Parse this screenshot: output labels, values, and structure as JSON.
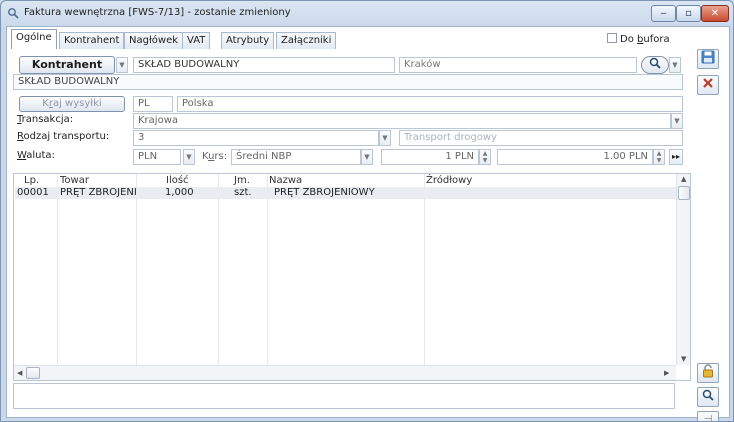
{
  "window": {
    "title": "Faktura wewnętrzna [FWS-7/13]  - zostanie zmieniony",
    "minimize_glyph": "‒",
    "maximize_glyph": "▫",
    "close_glyph": "✕"
  },
  "tabs": [
    {
      "label": "Ogólne",
      "active": true
    },
    {
      "label": "Kontrahent"
    },
    {
      "label": "Nagłówek"
    },
    {
      "label": "VAT"
    },
    {
      "label": "Atrybuty"
    },
    {
      "label": "Załączniki"
    }
  ],
  "do_bufora": {
    "label_prefix": "Do ",
    "label_underlined": "b",
    "label_suffix": "ufora",
    "checked": false
  },
  "kontrahent": {
    "button_label": "Kontrahent",
    "code": "SKŁAD BUDOWALNY",
    "city": "Kraków",
    "name": "SKŁAD BUDOWALNY"
  },
  "kraj": {
    "button_prefix": "K",
    "button_underlined": "r",
    "button_suffix": "aj wysyłki",
    "code": "PL",
    "name": "Polska"
  },
  "transakcja": {
    "label_u": "T",
    "label_rest": "ransakcja:",
    "value": "Krajowa"
  },
  "transport": {
    "label_u": "R",
    "label_rest": "odzaj transportu:",
    "value": "3",
    "description": "Transport drogowy"
  },
  "waluta": {
    "label_u": "W",
    "label_rest": "aluta:",
    "value": "PLN",
    "kurs_label_a": "K",
    "kurs_label_u": "u",
    "kurs_label_b": "rs:",
    "kurs_value": "Średni NBP",
    "rate_left": "1 PLN",
    "rate_right": "1.00 PLN"
  },
  "grid": {
    "columns": [
      "Lp.",
      "Towar",
      "Ilość",
      "Jm.",
      "Nazwa",
      "Źródłowy"
    ],
    "rows": [
      {
        "lp": "00001",
        "towar": "PRĘT ZBROJENIOWY",
        "ilosc": "1,000",
        "jm": "szt.",
        "nazwa": "PRĘT ZBROJENIOWY",
        "zrodlowy": ""
      }
    ]
  },
  "icons": {
    "save": "save-icon",
    "delete": "delete-icon",
    "lock": "lock-icon",
    "pin": "pin-icon",
    "search": "search-icon"
  },
  "colors": {
    "title_gradient_top": "#dbe6f3",
    "close_button": "#c94932",
    "delete_x": "#c0392b",
    "save_blue": "#2d6db5"
  }
}
